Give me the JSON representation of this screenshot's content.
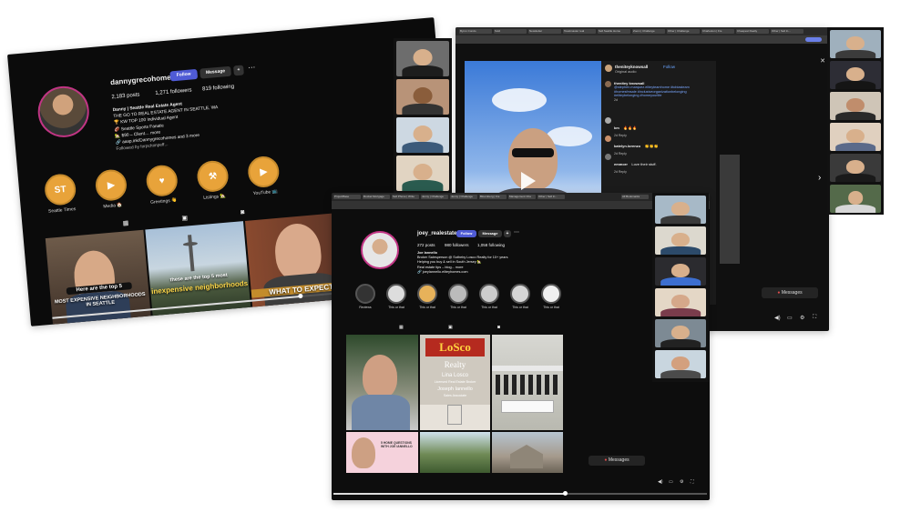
{
  "shot1": {
    "username": "dannygrecohomes",
    "follow_label": "Follow",
    "message_label": "Message",
    "posts": "2,183 posts",
    "followers": "1,271 followers",
    "following": "819 following",
    "bio": [
      "Danny | Seattle Real Estate Agent",
      "THE GO TO REAL ESTATE AGENT IN SEATTLE, WA",
      "🏆 KW TOP 100 Individual Agent",
      "🏈 Seattle Sports Fanatic",
      "🏡 $90 – Client… more",
      "🔗 aasp.ink/Dannygrecohomes and 3 more",
      "Followed by forpchimpeff..."
    ],
    "highlights": [
      "Seattle Times",
      "Media 🏠",
      "Greetings 👋",
      "Listings 🏡",
      "YouTube 📺"
    ],
    "highlight_glyphs": [
      "ST",
      "▶",
      "♥",
      "⚒",
      "▶"
    ],
    "reel1_caption_a": "Here are the top 5",
    "reel1_caption_b": "MOST EXPENSIVE NEIGHBORHOODS IN SEATTLE",
    "reel2_caption_a": "these are the top 5 most",
    "reel2_caption_b": "inexpensive neighborhoods",
    "reel3_caption": "WHAT TO EXPECT",
    "progress": 0.65
  },
  "shot2": {
    "tabs": [
      "Byron Condo",
      "Sold",
      "Newsletter",
      "Toastmaster real",
      "Sell Seattle Home",
      "Zoom | Challenge",
      "Other | Challenge",
      "Charleston | Fre",
      "Cheapest Realty",
      "Other | Sell In..."
    ],
    "post_user": "theniteyknowsall",
    "post_follow": "Follow",
    "post_audio": "Original audio",
    "comments": [
      {
        "user": "thenitey knowsall",
        "text": "@stephen.marquez.eliteyteamhome #tobiasteam #homesfmsale #inclusiveorganizationbelonging #eliteybelonging #homeyourlife",
        "meta": "2d"
      },
      {
        "user": "km",
        "text": "🔥🔥🔥",
        "meta": "2d   Reply"
      },
      {
        "user": "katelyn.lorenzo",
        "text": "👏👏👏",
        "meta": "2d   Reply"
      },
      {
        "user": "emmorr",
        "text": "Love their stuff.",
        "meta": "2d   Reply"
      }
    ],
    "message_hint": "Messages",
    "next_glyph": "›",
    "close_glyph": "✕"
  },
  "shot3": {
    "tabs": [
      "ProjectBase",
      "Rocket Mortgage",
      "Sell Phone | Write",
      "Jenny | Challenge",
      "Jenny | Challenge",
      "Bloomberg | Fre",
      "Management Cha",
      "Other | Sell In...",
      "All Bookmarks"
    ],
    "username": "joey_realestate",
    "follow_label": "Follow",
    "message_label": "Message",
    "posts": "272 posts",
    "followers": "980 followers",
    "following": "1,058 following",
    "bio": [
      "Joe Iannello",
      "Broker Salesperson @ Sotheby Losco Realty for 10+ years",
      "Helping you buy & sell in South Jersey 🏡",
      "Real estate tips – blog... more",
      "🔗 joeyIannello.eliteyhomes.com"
    ],
    "highlights": [
      "Reviews",
      "This or that",
      "This or that",
      "This or that",
      "This or that",
      "This or that",
      "This or that"
    ],
    "sign_brand": "LoSco",
    "sign_realty": "Realty",
    "sign_name": "Lina Losco",
    "sign_role": "Licensed Real Estate Broker",
    "sign_agent": "Joseph Iannello",
    "sign_agent_role": "Sales Associate",
    "pink_caption": "5 HOME QUESTIONS WITH JOE IANNELLO",
    "messages_label": "Messages",
    "progress": 0.62
  }
}
